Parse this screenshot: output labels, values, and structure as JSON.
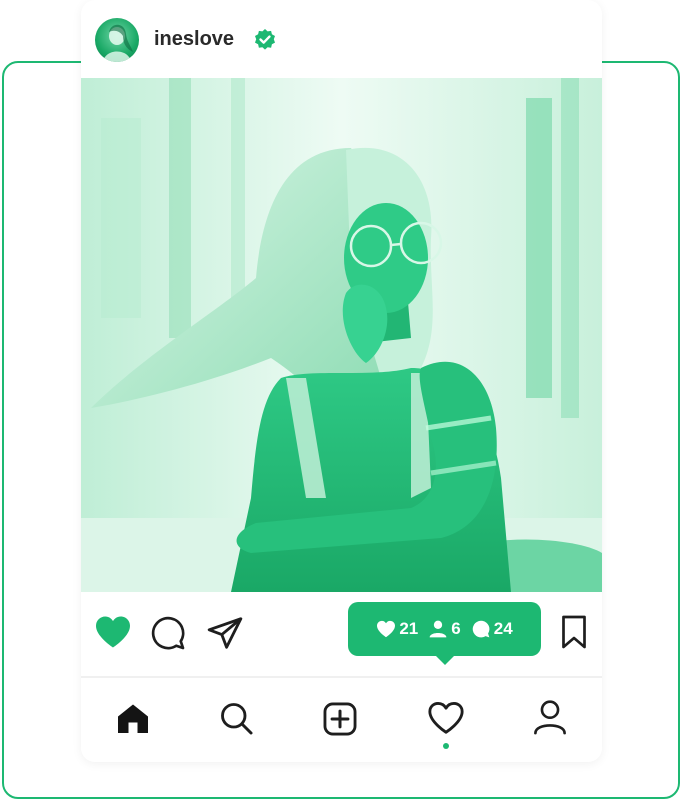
{
  "post": {
    "username": "ineslove",
    "verified": true
  },
  "stats": {
    "likes": "21",
    "followers": "6",
    "comments": "24"
  },
  "state": {
    "liked": true,
    "active_tab": "activity"
  },
  "icons": {
    "like": "heart-icon",
    "comment": "comment-bubble-icon",
    "share": "paper-plane-icon",
    "save": "bookmark-icon",
    "verified": "verified-badge-icon"
  },
  "nav": [
    {
      "name": "home",
      "icon": "home-icon"
    },
    {
      "name": "search",
      "icon": "search-icon"
    },
    {
      "name": "create",
      "icon": "plus-square-icon"
    },
    {
      "name": "activity",
      "icon": "heart-icon"
    },
    {
      "name": "profile",
      "icon": "user-icon"
    }
  ],
  "colors": {
    "accent": "#1db872",
    "text": "#2a2a2a",
    "photo_tint": "#23c27c"
  }
}
